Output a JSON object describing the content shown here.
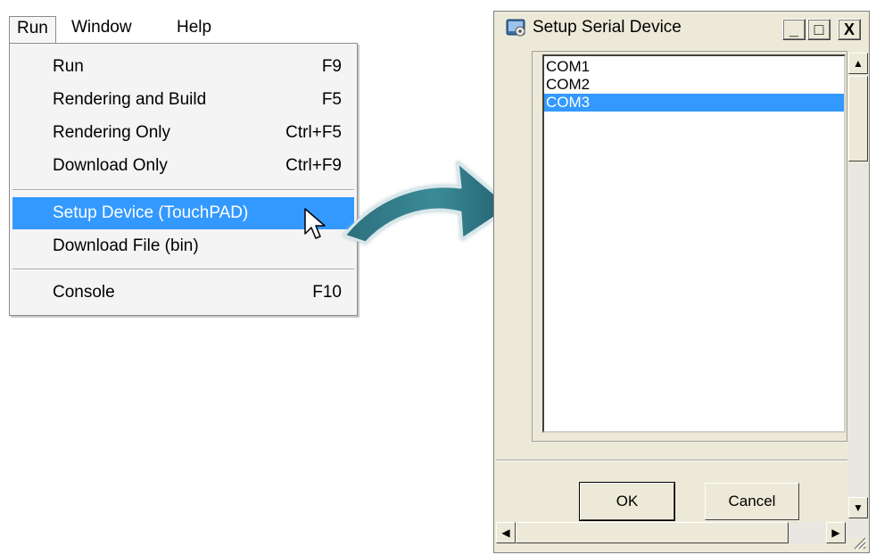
{
  "menubar": {
    "items": [
      "Run",
      "Window",
      "Help"
    ]
  },
  "menu": {
    "items": [
      {
        "label": "Run",
        "shortcut": "F9"
      },
      {
        "label": "Rendering and Build",
        "shortcut": "F5"
      },
      {
        "label": "Rendering Only",
        "shortcut": "Ctrl+F5"
      },
      {
        "label": "Download Only",
        "shortcut": "Ctrl+F9"
      },
      {
        "label": "Setup Device (TouchPAD)",
        "shortcut": ""
      },
      {
        "label": "Download File (bin)",
        "shortcut": ""
      },
      {
        "label": "Console",
        "shortcut": "F10"
      }
    ],
    "highlighted_index": 4,
    "highlight_color": "#3399ff"
  },
  "dialog": {
    "title": "Setup Serial Device",
    "minimize": "_",
    "maximize": "□",
    "close": "X",
    "ports": [
      "COM1",
      "COM2",
      "COM3"
    ],
    "selected_index": 2,
    "ok_label": "OK",
    "cancel_label": "Cancel",
    "background_color": "#ece9d8"
  },
  "icons": {
    "app_icon": "dialog-app-icon",
    "cursor": "mouse-pointer-icon",
    "arrow": "curved-arrow-icon"
  }
}
